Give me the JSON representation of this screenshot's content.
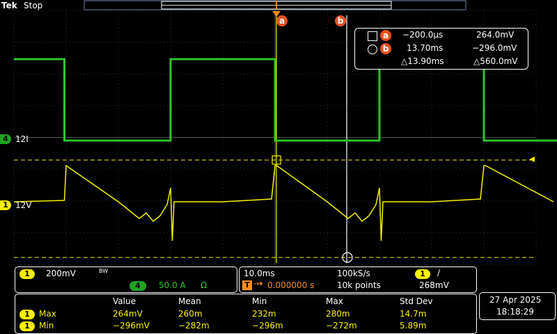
{
  "status": {
    "brand": "Tek",
    "run_state": "Stop"
  },
  "cursors": {
    "a_label": "a",
    "b_label": "b",
    "a_time": "−200.0µs",
    "a_volt": "264.0mV",
    "b_time": "13.70ms",
    "b_volt": "−296.0mV",
    "delta_time": "△13.90ms",
    "delta_volt": "△560.0mV"
  },
  "channels": {
    "ch4": {
      "num": "4",
      "label": "12I",
      "scale": "50.0 A",
      "coupling_icon": "Ω",
      "color": "#2ec42e"
    },
    "ch1": {
      "num": "1",
      "label": "12V",
      "scale": "200mV",
      "bw_icon": "BW",
      "color": "#f7f000"
    }
  },
  "trigger": {
    "marker": "T"
  },
  "horizontal": {
    "timebase": "10.0ms",
    "sample_rate": "100kS/s",
    "delay": "0.000000 s",
    "record_length": "10k points",
    "trigger_source": "1",
    "trigger_slope": "∕",
    "trigger_level": "268mV"
  },
  "measurements": {
    "headers": [
      "Value",
      "Mean",
      "Min",
      "Max",
      "Std Dev"
    ],
    "rows": [
      {
        "ch": "1",
        "name": "Max",
        "values": [
          "264mV",
          "260m",
          "232m",
          "280m",
          "14.7m"
        ]
      },
      {
        "ch": "1",
        "name": "Min",
        "values": [
          "−296mV",
          "−282m",
          "−296m",
          "−272m",
          "5.89m"
        ]
      }
    ]
  },
  "datetime": {
    "date": "27 Apr  2025",
    "time": "18:18:29"
  },
  "chart_data": {
    "type": "line",
    "series": [
      {
        "name": "12I",
        "color": "#2ec42e",
        "x": [
          0.0,
          1.45,
          1.45,
          4.5,
          4.5,
          7.5,
          7.5,
          10.5,
          10.5,
          13.5,
          13.5,
          16.5,
          16.5,
          19.5
        ],
        "values": [
          1,
          1,
          0,
          0,
          1,
          1,
          0,
          0,
          1,
          1,
          0,
          0,
          1,
          1
        ]
      },
      {
        "name": "12V",
        "color": "#f7f000",
        "x": [
          0.0,
          1.45,
          1.5,
          3.0,
          3.6,
          3.8,
          4.0,
          4.2,
          4.4,
          4.5,
          4.55,
          4.6,
          4.7,
          6.0,
          7.4,
          7.5,
          7.55,
          9.0,
          9.6,
          9.8,
          10.0,
          10.2,
          10.4,
          10.5,
          10.55,
          10.6,
          10.7,
          12.0,
          13.4,
          13.5,
          13.55,
          15.5
        ],
        "values": [
          0.0,
          0.01,
          0.26,
          0.0,
          -0.12,
          -0.08,
          -0.14,
          -0.1,
          -0.02,
          0.1,
          -0.28,
          0.0,
          0.0,
          0.0,
          0.02,
          0.26,
          0.26,
          0.0,
          -0.12,
          -0.08,
          -0.14,
          -0.1,
          -0.02,
          0.1,
          -0.28,
          0.0,
          0.0,
          0.0,
          0.02,
          0.26,
          0.26,
          0.0
        ]
      }
    ],
    "xlabel": "",
    "ylabel": "",
    "xlim": [
      0,
      15.0
    ],
    "grid": true
  }
}
